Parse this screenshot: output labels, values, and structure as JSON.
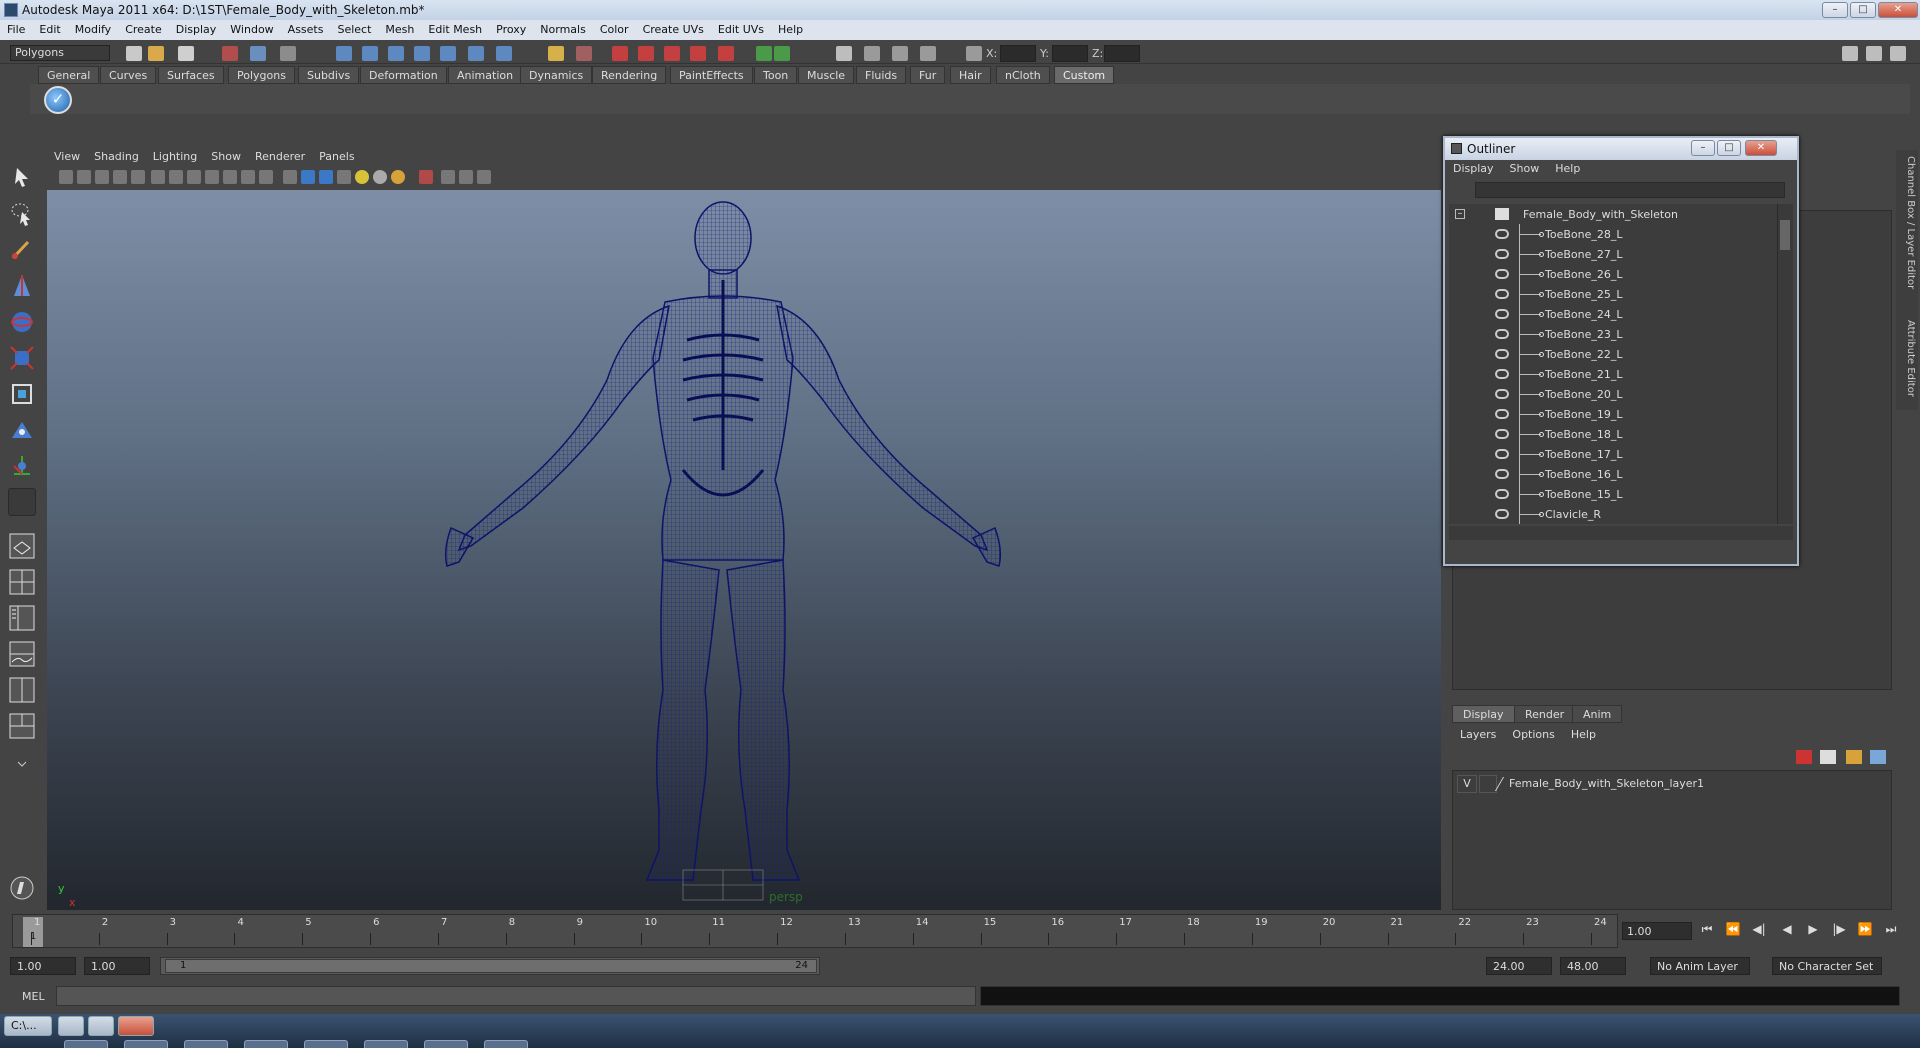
{
  "window": {
    "title": "Autodesk Maya 2011 x64: D:\\1ST\\Female_Body_with_Skeleton.mb*",
    "minimize": "–",
    "maximize": "□",
    "close": "✕"
  },
  "menubar": [
    "File",
    "Edit",
    "Modify",
    "Create",
    "Display",
    "Window",
    "Assets",
    "Select",
    "Mesh",
    "Edit Mesh",
    "Proxy",
    "Normals",
    "Color",
    "Create UVs",
    "Edit UVs",
    "Help"
  ],
  "status": {
    "mode": "Polygons",
    "x_label": "X:",
    "y_label": "Y:",
    "z_label": "Z:"
  },
  "shelf": {
    "tabs": [
      "General",
      "Curves",
      "Surfaces",
      "Polygons",
      "Subdivs",
      "Deformation",
      "Animation",
      "Dynamics",
      "Rendering",
      "PaintEffects",
      "Toon",
      "Muscle",
      "Fluids",
      "Fur",
      "Hair",
      "nCloth",
      "Custom"
    ],
    "active": "Custom"
  },
  "viewport": {
    "menus": [
      "View",
      "Shading",
      "Lighting",
      "Show",
      "Renderer",
      "Panels"
    ],
    "camera": "persp",
    "axis_y": "y",
    "axis_x": "x"
  },
  "outliner": {
    "title": "Outliner",
    "menus": [
      "Display",
      "Show",
      "Help"
    ],
    "root": "Female_Body_with_Skeleton",
    "collapse": "–",
    "items": [
      "ToeBone_28_L",
      "ToeBone_27_L",
      "ToeBone_26_L",
      "ToeBone_25_L",
      "ToeBone_24_L",
      "ToeBone_23_L",
      "ToeBone_22_L",
      "ToeBone_21_L",
      "ToeBone_20_L",
      "ToeBone_19_L",
      "ToeBone_18_L",
      "ToeBone_17_L",
      "ToeBone_16_L",
      "ToeBone_15_L",
      "Clavicle_R"
    ]
  },
  "right_panel": {
    "vertical_tabs": [
      "Channel Box / Layer Editor",
      "Attribute Editor"
    ]
  },
  "layers": {
    "tabs": [
      "Display",
      "Render",
      "Anim"
    ],
    "active_tab": "Display",
    "menus": [
      "Layers",
      "Options",
      "Help"
    ],
    "visibility": "V",
    "layer_name": "Female_Body_with_Skeleton_layer1"
  },
  "timeline": {
    "labels": [
      "1",
      "2",
      "3",
      "4",
      "5",
      "6",
      "7",
      "8",
      "9",
      "10",
      "11",
      "12",
      "13",
      "14",
      "15",
      "16",
      "17",
      "18",
      "19",
      "20",
      "21",
      "22",
      "23",
      "24"
    ],
    "current_frame": "1",
    "current_time": "1.00"
  },
  "range": {
    "start_time": "1.00",
    "playback_start": "1.00",
    "range_start_label": "1",
    "range_end_label": "24",
    "playback_end": "24.00",
    "end_time": "48.00",
    "anim_layer": "No Anim Layer",
    "character_set": "No Character Set"
  },
  "command": {
    "label": "MEL"
  },
  "taskbar": {
    "item": "C:\\..."
  },
  "colors": {
    "mesh": "#101a7a",
    "accent": "#5b9bd5"
  }
}
